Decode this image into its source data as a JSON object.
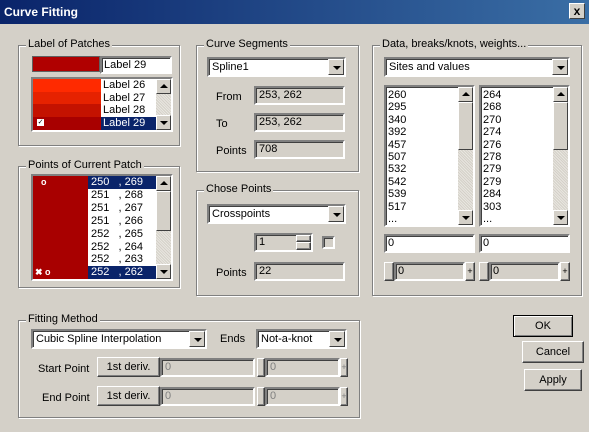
{
  "window": {
    "title": "Curve Fitting",
    "close_label": "x"
  },
  "patches": {
    "group_title": "Label of Patches",
    "current_label": "Label 29",
    "items": [
      {
        "label": "Label 26",
        "color": "#ff2a00"
      },
      {
        "label": "Label 27",
        "color": "#e62200"
      },
      {
        "label": "Label 28",
        "color": "#c41200"
      },
      {
        "label": "Label 29",
        "color": "#a80000",
        "selected": true,
        "checked": true
      }
    ],
    "preview_color": "#b00000"
  },
  "points_patch": {
    "group_title": "Points of Current Patch",
    "rows": [
      {
        "text": "250   , 269",
        "marker": "o",
        "selected": true
      },
      {
        "text": "251   , 268",
        "marker": ""
      },
      {
        "text": "251   , 267",
        "marker": ""
      },
      {
        "text": "251   , 266",
        "marker": ""
      },
      {
        "text": "252   , 265",
        "marker": ""
      },
      {
        "text": "252   , 264",
        "marker": ""
      },
      {
        "text": "252   , 263",
        "marker": ""
      },
      {
        "text": "252   , 262",
        "marker": "xo",
        "selected": true
      }
    ]
  },
  "segments": {
    "group_title": "Curve Segments",
    "selected": "Spline1",
    "from_label": "From",
    "from_value": "253, 262",
    "to_label": "To",
    "to_value": "253, 262",
    "points_label": "Points",
    "points_value": "708"
  },
  "chose_points": {
    "group_title": "Chose Points",
    "selected": "Crosspoints",
    "spin_value": "1",
    "points_label": "Points",
    "points_value": "22"
  },
  "data_group": {
    "group_title": "Data, breaks/knots, weights...",
    "selected": "Sites and values",
    "list1": [
      "260",
      "295",
      "340",
      "392",
      "457",
      "507",
      "532",
      "542",
      "539",
      "517",
      "..."
    ],
    "list2": [
      "264",
      "268",
      "270",
      "274",
      "276",
      "278",
      "279",
      "279",
      "284",
      "303",
      "..."
    ],
    "input1": "0",
    "input2": "0",
    "spin1": "0",
    "spin2": "0"
  },
  "fitting": {
    "group_title": "Fitting Method",
    "method": "Cubic Spline Interpolation",
    "ends_label": "Ends",
    "ends_value": "Not-a-knot",
    "start_label": "Start Point",
    "start_btn": "1st deriv.",
    "start_value": "0",
    "start_spin": "0",
    "end_label": "End Point",
    "end_btn": "1st deriv.",
    "end_value": "0",
    "end_spin": "0"
  },
  "buttons": {
    "ok": "OK",
    "cancel": "Cancel",
    "apply": "Apply"
  }
}
